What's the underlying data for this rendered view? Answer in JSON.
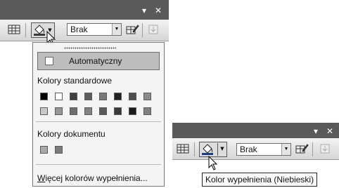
{
  "toolbar": {
    "dropdown_glyph": "▾",
    "close_glyph": "✕",
    "combo_arrow_glyph": "▼",
    "split_arrow_glyph": "▼",
    "line_style_value": "Brak",
    "icons": [
      "table-grid-icon",
      "paint-bucket-icon",
      "pen-table-icon",
      "disabled-arrow-icon"
    ]
  },
  "fill_menu": {
    "automatic_label": "Automatyczny",
    "standard_colors_label": "Kolory standardowe",
    "standard_colors": [
      [
        "#000000",
        "#ffffff",
        "#3f3f3f",
        "#5c5c5c",
        "#7a7a7a",
        "#222222",
        "#4d4d4d",
        "#8a8a8a"
      ],
      [
        "#c8c8c8",
        "#969696",
        "#6e6e6e",
        "#828282",
        "#5a5a5a",
        "#3a3a3a",
        "#1a1a1a",
        "#808080"
      ]
    ],
    "document_colors_label": "Kolory dokumentu",
    "document_colors": [
      "#a8a8a8",
      "#7c7c7c"
    ],
    "more_colors_prefix": "",
    "more_colors_hotkey": "W",
    "more_colors_rest": "ięcej kolorów wypełnienia..."
  },
  "tooltip": {
    "text": "Kolor wypełnienia (Niebieski)"
  },
  "colors": {
    "title_bar": "#5a5a5a",
    "fill_indicator": "#1f3a8a"
  }
}
